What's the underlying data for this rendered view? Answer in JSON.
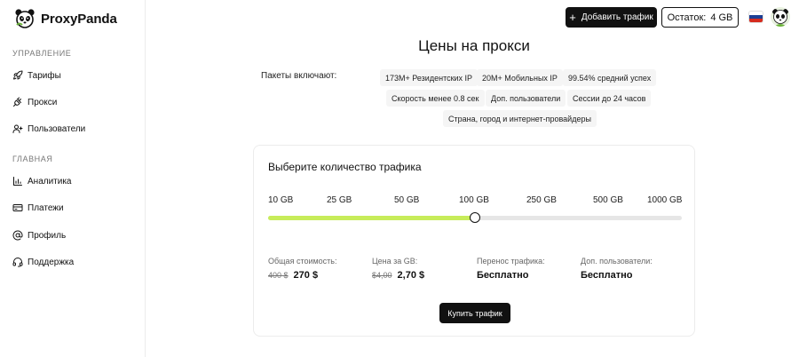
{
  "app": {
    "name": "ProxyPanda"
  },
  "sidebar": {
    "sections": [
      {
        "label": "УПРАВЛЕНИЕ",
        "items": [
          {
            "label": "Тарифы",
            "icon": "rocket-icon"
          },
          {
            "label": "Прокси",
            "icon": "plug-icon"
          },
          {
            "label": "Пользователи",
            "icon": "user-plus-icon"
          }
        ]
      },
      {
        "label": "ГЛАВНАЯ",
        "items": [
          {
            "label": "Аналитика",
            "icon": "bar-chart-icon"
          },
          {
            "label": "Платежи",
            "icon": "credit-card-icon"
          },
          {
            "label": "Профиль",
            "icon": "at-sign-icon"
          },
          {
            "label": "Поддержка",
            "icon": "headset-icon"
          }
        ]
      }
    ]
  },
  "topbar": {
    "add_traffic_label": "Добавить трафик",
    "balance_label": "Остаток:",
    "balance_value": "4 GB",
    "language_flag_colors": [
      "#ffffff",
      "#1c3f94",
      "#d52b1e"
    ]
  },
  "main": {
    "title": "Цены на прокси",
    "includes_label": "Пакеты включают:",
    "features": [
      "173M+ Резидентских IP",
      "20M+ Мобильных IP",
      "99.54% средний успех",
      "Скорость менее 0.8 сек",
      "Доп. пользователи",
      "Сессии до 24 часов",
      "Страна, город и интернет-провайдеры"
    ]
  },
  "traffic_card": {
    "title": "Выберите количество трафика",
    "options": [
      "10 GB",
      "25 GB",
      "50 GB",
      "100 GB",
      "250 GB",
      "500 GB",
      "1000 GB"
    ],
    "selected_index": 3,
    "fill_fraction": 0.5,
    "stats": {
      "total_cost_label": "Общая стоимость:",
      "total_cost_old": "400 $",
      "total_cost_new": "270 $",
      "price_per_gb_label": "Цена за GB:",
      "price_per_gb_old": "$4,00",
      "price_per_gb_new": "2,70 $",
      "rollover_label": "Перенос трафика:",
      "rollover_value": "Бесплатно",
      "extra_users_label": "Доп. пользователи:",
      "extra_users_value": "Бесплатно"
    },
    "buy_label": "Купить трафик",
    "accent_color": "#c7ec5a"
  }
}
